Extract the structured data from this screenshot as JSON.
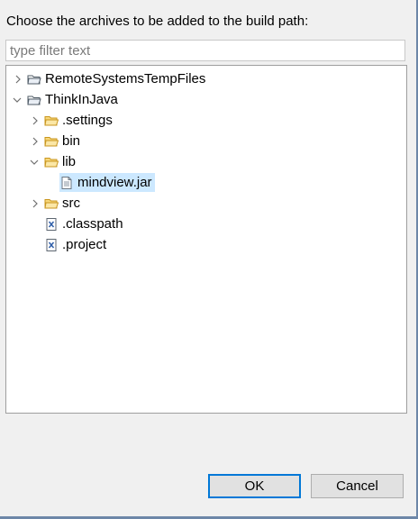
{
  "dialog": {
    "prompt": "Choose the archives to be added to the build path:",
    "filter_placeholder": "type filter text",
    "filter_value": ""
  },
  "tree": {
    "nodes": [
      {
        "label": "RemoteSystemsTempFiles",
        "icon": "project-folder-icon",
        "state": "collapsed"
      },
      {
        "label": "ThinkInJava",
        "icon": "project-folder-icon",
        "state": "expanded"
      },
      {
        "label": ".settings",
        "icon": "folder-icon",
        "state": "collapsed"
      },
      {
        "label": "bin",
        "icon": "folder-icon",
        "state": "collapsed"
      },
      {
        "label": "lib",
        "icon": "folder-icon",
        "state": "expanded"
      },
      {
        "label": "mindview.jar",
        "icon": "file-icon",
        "state": "leaf",
        "selected": true
      },
      {
        "label": "src",
        "icon": "folder-icon",
        "state": "collapsed"
      },
      {
        "label": ".classpath",
        "icon": "xml-file-icon",
        "state": "leaf"
      },
      {
        "label": ".project",
        "icon": "xml-file-icon",
        "state": "leaf"
      }
    ]
  },
  "buttons": {
    "ok_label": "OK",
    "cancel_label": "Cancel"
  },
  "colors": {
    "selection": "#cce8ff",
    "default_button_border": "#0078d7",
    "folder": "#e8b84a",
    "window_border": "#6d87a8"
  }
}
